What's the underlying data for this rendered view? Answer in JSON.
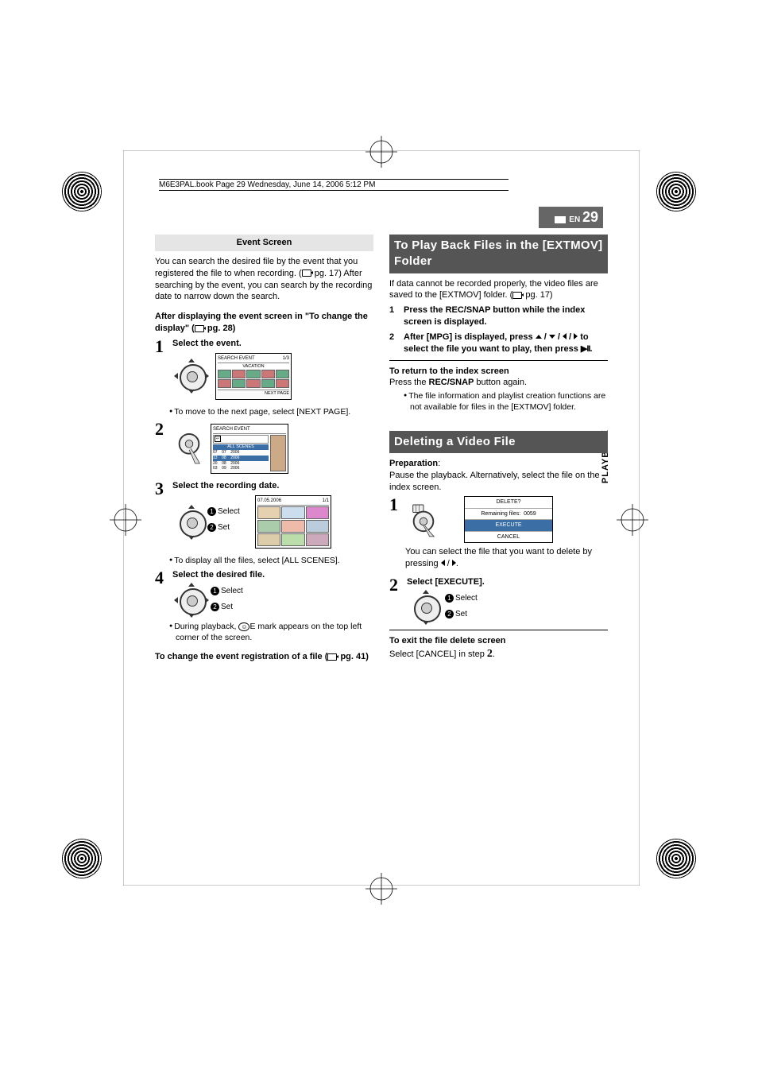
{
  "meta": {
    "book_stamp": "M6E3PAL.book  Page 29  Wednesday, June 14, 2006  5:12 PM",
    "lang_code": "EN",
    "page_no": "29",
    "side_tab": "PLAYBACK"
  },
  "left": {
    "event_heading": "Event Screen",
    "intro": "You can search the desired file by the event that you registered the file to when recording. (",
    "intro2": " pg. 17) After searching by the event, you can search by the recording date to narrow down the search.",
    "after_display_1": "After displaying the event screen in \"To change the display\" (",
    "after_display_2": " pg. 28)",
    "step1": "Select the event.",
    "screen1": {
      "title": "SEARCH EVENT",
      "page": "1/3",
      "sub": "VACATION",
      "footer": "NEXT PAGE"
    },
    "bullet1": "To move to the next page, select [NEXT PAGE].",
    "screen2": {
      "title": "SEARCH EVENT",
      "row_label": "ALL SCENES",
      "rows": [
        "07    07    2006",
        "13    08    2006",
        "20    08    2006",
        "03    09    2006"
      ]
    },
    "step3": "Select the recording date.",
    "sel_label": "Select",
    "set_label": "Set",
    "screen3": {
      "title": "07.05.2006",
      "page": "1/1"
    },
    "bullet3": "To display all the files, select [ALL SCENES].",
    "step4": "Select the desired file.",
    "bullet4a": "During playback, ",
    "bullet4_icon": "E",
    "bullet4b": " mark appears on the top left corner of the screen.",
    "change_event_1": "To change the event registration of a file (",
    "change_event_2": " pg. 41)"
  },
  "right": {
    "sectionA": "To Play Back Files in the [EXTMOV] Folder",
    "a_intro": "If data cannot be recorded properly, the video files are saved to the [EXTMOV] folder. (",
    "a_intro2": " pg. 17)",
    "a_step1": "Press the REC/SNAP button while the index screen is displayed.",
    "a_step2a": "After [MPG] is displayed, press ",
    "a_step2b": " to select the file you want to play, then press ",
    "return_h": "To return to the index screen",
    "return_body_a": "Press the ",
    "return_body_b": "REC/SNAP",
    "return_body_c": " button again.",
    "return_bullet": "The file information and playlist creation functions are not available for files in the [EXTMOV] folder.",
    "sectionB": "Deleting a Video File",
    "prep_h": "Preparation",
    "prep_body": "Pause the playback. Alternatively, select the file on the index screen.",
    "delete_menu": {
      "title": "DELETE?",
      "remaining_label": "Remaining files:",
      "remaining_value": "0059",
      "execute": "EXECUTE",
      "cancel": "CANCEL"
    },
    "b_note_a": "You can select the file that you want to delete by pressing ",
    "b_step2": "Select [EXECUTE].",
    "sel_label": "Select",
    "set_label": "Set",
    "exit_h": "To exit the file delete screen",
    "exit_body_a": "Select [CANCEL] in step ",
    "exit_body_b": "2",
    "exit_body_c": "."
  }
}
